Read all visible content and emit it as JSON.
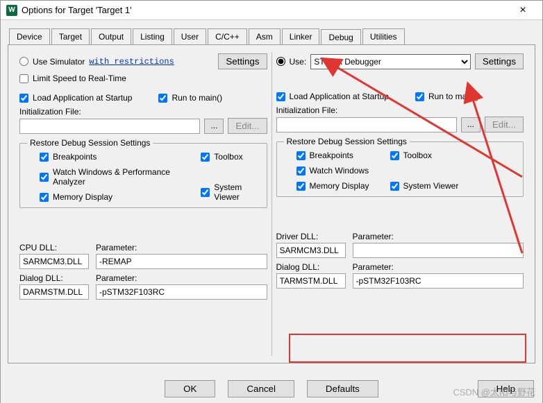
{
  "window": {
    "title": "Options for Target 'Target 1'",
    "icon": "W"
  },
  "tabs": [
    "Device",
    "Target",
    "Output",
    "Listing",
    "User",
    "C/C++",
    "Asm",
    "Linker",
    "Debug",
    "Utilities"
  ],
  "active_tab": "Debug",
  "left": {
    "use_sim": "Use Simulator",
    "restrictions_link": "with restrictions",
    "settings": "Settings",
    "limit_speed": "Limit Speed to Real-Time",
    "load_app": "Load Application at Startup",
    "run_main": "Run to main()",
    "init_file_label": "Initialization File:",
    "init_file": "",
    "edit_btn": "Edit...",
    "restore_legend": "Restore Debug Session Settings",
    "breakpoints": "Breakpoints",
    "toolbox": "Toolbox",
    "watch": "Watch Windows & Performance Analyzer",
    "memory": "Memory Display",
    "sysview": "System Viewer",
    "cpu_dll_lbl": "CPU DLL:",
    "parameter_lbl": "Parameter:",
    "cpu_dll": "SARMCM3.DLL",
    "cpu_param": "-REMAP",
    "dialog_dll_lbl": "Dialog DLL:",
    "dialog_dll": "DARMSTM.DLL",
    "dialog_param": "-pSTM32F103RC"
  },
  "right": {
    "use": "Use:",
    "use_sel": "ST-Link Debugger",
    "settings": "Settings",
    "load_app": "Load Application at Startup",
    "run_main": "Run to main()",
    "init_file_label": "Initialization File:",
    "init_file": "",
    "edit_btn": "Edit...",
    "restore_legend": "Restore Debug Session Settings",
    "breakpoints": "Breakpoints",
    "toolbox": "Toolbox",
    "watch": "Watch Windows",
    "memory": "Memory Display",
    "sysview": "System Viewer",
    "driver_dll_lbl": "Driver DLL:",
    "parameter_lbl": "Parameter:",
    "driver_dll": "SARMCM3.DLL",
    "driver_param": "",
    "dialog_dll_lbl": "Dialog DLL:",
    "dialog_dll": "TARMSTM.DLL",
    "dialog_param": "-pSTM32F103RC"
  },
  "bottom": {
    "ok": "OK",
    "cancel": "Cancel",
    "defaults": "Defaults",
    "help": "Help"
  },
  "watermark": "CSDN @太阳与野花"
}
